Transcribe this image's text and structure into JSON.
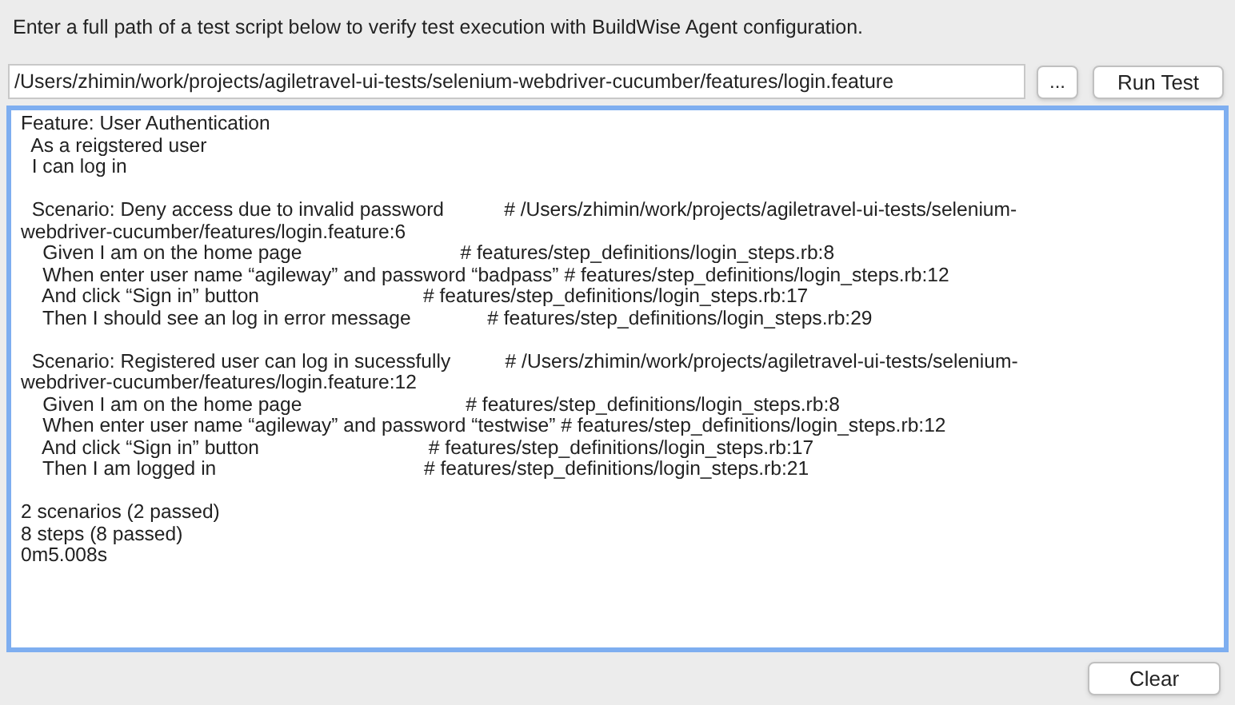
{
  "instruction": "Enter a full path of a test script below to verify test execution with BuildWise Agent configuration.",
  "path_field": {
    "value": "/Users/zhimin/work/projects/agiletravel-ui-tests/selenium-webdriver-cucumber/features/login.feature"
  },
  "browse_button": "...",
  "run_button": "Run Test",
  "output": {
    "focused": true,
    "blocks": [
      [
        "Feature: User Authentication",
        "  As a reigstered user",
        "  I can log in"
      ],
      [
        "  Scenario: Deny access due to invalid password           # /Users/zhimin/work/projects/agiletravel-ui-tests/selenium-",
        "webdriver-cucumber/features/login.feature:6",
        "    Given I am on the home page                             # features/step_definitions/login_steps.rb:8",
        "    When enter user name “agileway” and password “badpass” # features/step_definitions/login_steps.rb:12",
        "    And click “Sign in” button                              # features/step_definitions/login_steps.rb:17",
        "    Then I should see an log in error message              # features/step_definitions/login_steps.rb:29"
      ],
      [
        "  Scenario: Registered user can log in sucessfully          # /Users/zhimin/work/projects/agiletravel-ui-tests/selenium-",
        "webdriver-cucumber/features/login.feature:12",
        "    Given I am on the home page                              # features/step_definitions/login_steps.rb:8",
        "    When enter user name “agileway” and password “testwise” # features/step_definitions/login_steps.rb:12",
        "    And click “Sign in” button                               # features/step_definitions/login_steps.rb:17",
        "    Then I am logged in                                      # features/step_definitions/login_steps.rb:21"
      ],
      [
        "2 scenarios (2 passed)",
        "8 steps (8 passed)",
        "0m5.008s"
      ]
    ]
  },
  "clear_button": "Clear"
}
